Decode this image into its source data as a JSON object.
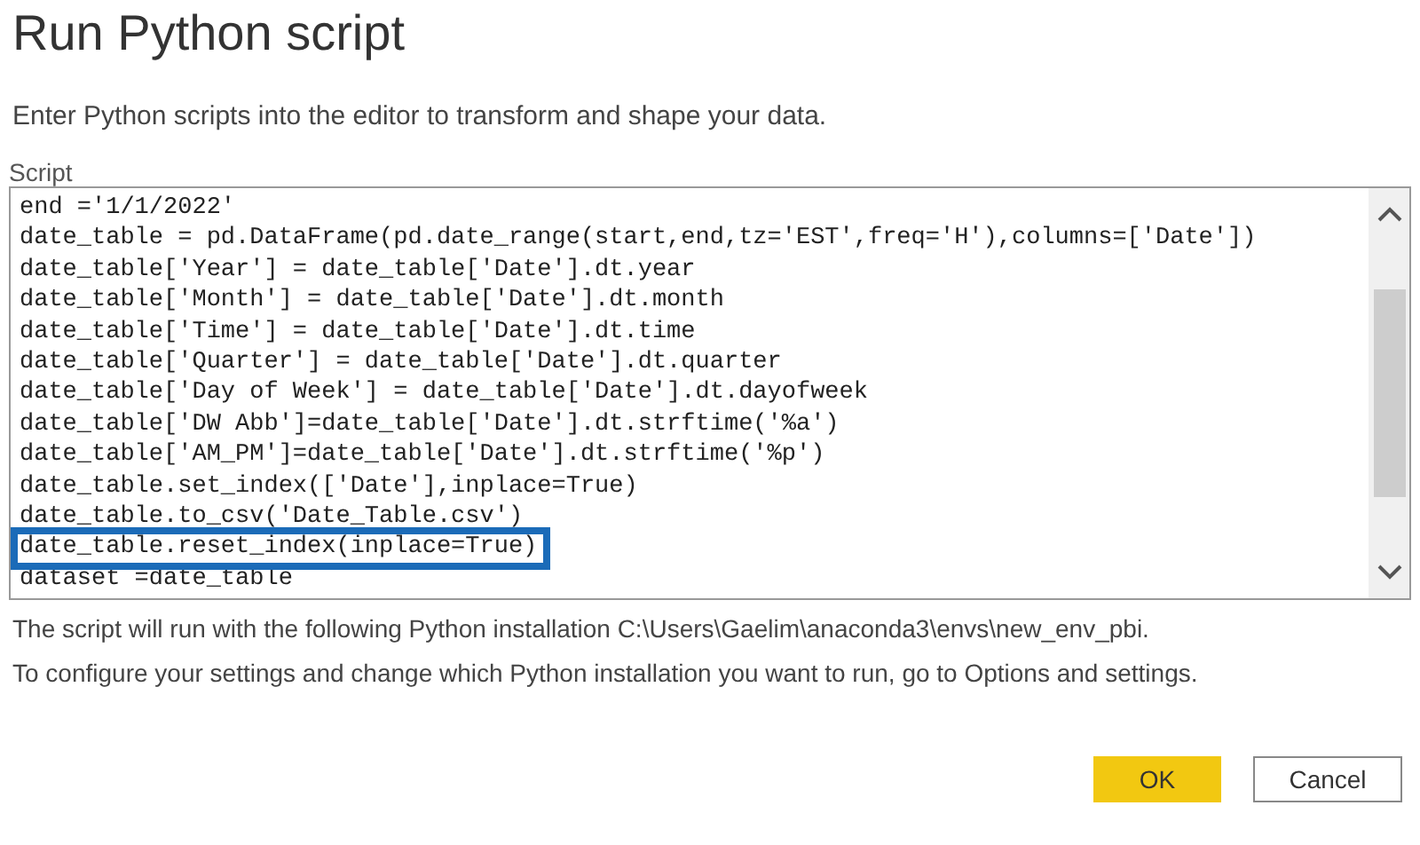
{
  "dialog": {
    "title": "Run Python script",
    "description": "Enter Python scripts into the editor to transform and shape your data."
  },
  "editor": {
    "label": "Script",
    "lines": [
      {
        "text": "end ='1/1/2022'",
        "highlighted": false
      },
      {
        "text": "date_table = pd.DataFrame(pd.date_range(start,end,tz='EST',freq='H'),columns=['Date'])",
        "highlighted": false
      },
      {
        "text": "date_table['Year'] = date_table['Date'].dt.year",
        "highlighted": false
      },
      {
        "text": "date_table['Month'] = date_table['Date'].dt.month",
        "highlighted": false
      },
      {
        "text": "date_table['Time'] = date_table['Date'].dt.time",
        "highlighted": false
      },
      {
        "text": "date_table['Quarter'] = date_table['Date'].dt.quarter",
        "highlighted": false
      },
      {
        "text": "date_table['Day of Week'] = date_table['Date'].dt.dayofweek",
        "highlighted": false
      },
      {
        "text": "date_table['DW Abb']=date_table['Date'].dt.strftime('%a')",
        "highlighted": false
      },
      {
        "text": "date_table['AM_PM']=date_table['Date'].dt.strftime('%p')",
        "highlighted": false
      },
      {
        "text": "date_table.set_index(['Date'],inplace=True)",
        "highlighted": false
      },
      {
        "text": "date_table.to_csv('Date_Table.csv')",
        "highlighted": false
      },
      {
        "text": "date_table.reset_index(inplace=True)",
        "highlighted": true
      },
      {
        "text": "dataset =date_table",
        "highlighted": false
      }
    ]
  },
  "info": [
    "The script will run with the following Python installation C:\\Users\\Gaelim\\anaconda3\\envs\\new_env_pbi.",
    "To configure your settings and change which Python installation you want to run, go to Options and settings."
  ],
  "buttons": [
    {
      "label": "OK",
      "kind": "primary"
    },
    {
      "label": "Cancel",
      "kind": "secondary"
    }
  ]
}
